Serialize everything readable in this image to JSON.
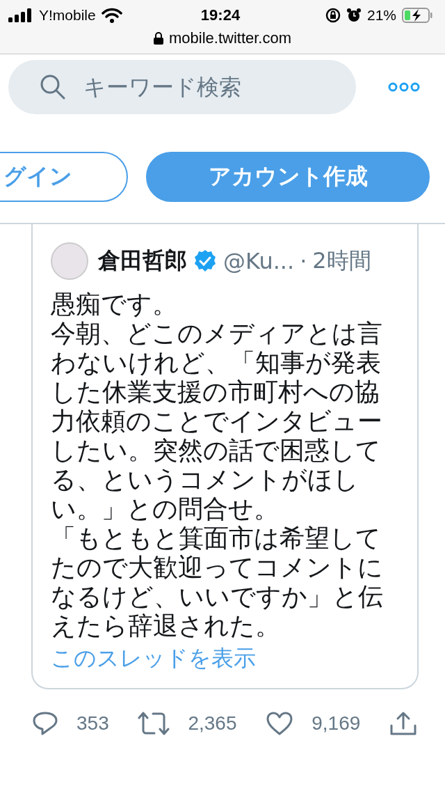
{
  "status_bar": {
    "carrier": "Y!mobile",
    "time": "19:24",
    "battery": "21%",
    "url": "mobile.twitter.com"
  },
  "search": {
    "placeholder": "キーワード検索"
  },
  "buttons": [
    {
      "label": "グイン",
      "kind": "outline"
    },
    {
      "label": "アカウント作成",
      "kind": "filled"
    }
  ],
  "tweet": {
    "name": "倉田哲郎",
    "verified": true,
    "handle": "@Ku...",
    "separator": "·",
    "time": "2時間",
    "paragraphs": [
      "愚痴です。",
      "今朝、どこのメディアとは言わないけれど、「知事が発表した休業支援の市町村への協力依頼のことでインタビューしたい。突然の話で困惑してる、というコメントがほしい。」との問合せ。",
      "「もともと箕面市は希望してたので大歓迎ってコメントになるけど、いいですか」と伝えたら辞退された。"
    ],
    "thread_link": "このスレッドを表示"
  },
  "actions": [
    {
      "kind": "reply",
      "count": "353"
    },
    {
      "kind": "retweet",
      "count": "2,365"
    },
    {
      "kind": "like",
      "count": "9,169"
    },
    {
      "kind": "share"
    }
  ]
}
